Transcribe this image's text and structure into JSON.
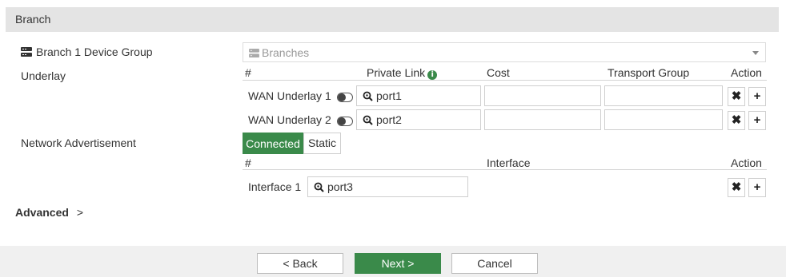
{
  "section": {
    "title": "Branch"
  },
  "device_group": {
    "label": "Branch 1 Device Group",
    "selected": "Branches"
  },
  "underlay": {
    "label": "Underlay",
    "columns": {
      "index": "#",
      "private_link": "Private Link",
      "cost": "Cost",
      "transport_group": "Transport Group",
      "action": "Action"
    },
    "rows": [
      {
        "name": "WAN Underlay 1",
        "port": "port1",
        "cost": "",
        "transport_group": ""
      },
      {
        "name": "WAN Underlay 2",
        "port": "port2",
        "cost": "",
        "transport_group": ""
      }
    ],
    "remove_symbol": "✖",
    "add_symbol": "+"
  },
  "network_advertisement": {
    "label": "Network Advertisement",
    "options": [
      "Connected",
      "Static"
    ],
    "selected": "Connected",
    "columns": {
      "index": "#",
      "interface": "Interface",
      "action": "Action"
    },
    "rows": [
      {
        "name": "Interface 1",
        "port": "port3"
      }
    ]
  },
  "advanced": {
    "label": "Advanced",
    "chevron": ">"
  },
  "footer": {
    "back": "< Back",
    "next": "Next >",
    "cancel": "Cancel"
  },
  "colors": {
    "accent": "#3a8a4a",
    "header_bg": "#e4e4e4",
    "footer_bg": "#f0f0f0"
  },
  "icons": {
    "device_group": "server-stack-icon",
    "search": "magnifier-icon",
    "info": "info-icon"
  }
}
